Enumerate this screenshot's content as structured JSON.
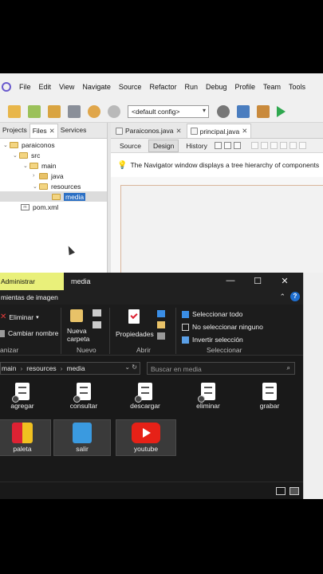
{
  "netbeans": {
    "menu": [
      "File",
      "Edit",
      "View",
      "Navigate",
      "Source",
      "Refactor",
      "Run",
      "Debug",
      "Profile",
      "Team",
      "Tools"
    ],
    "config_select": "<default config>",
    "left_tabs": [
      "Projects",
      "Files",
      "Services"
    ],
    "tree": {
      "root": "paraiconos",
      "src": "src",
      "main": "main",
      "java": "java",
      "resources": "resources",
      "media": "media",
      "pom": "pom.xml"
    },
    "editor_tabs": [
      "Paraiconos.java",
      "principal.java"
    ],
    "design_buttons": [
      "Source",
      "Design",
      "History"
    ],
    "navigator_hint": "The Navigator window displays a tree hierarchy of components"
  },
  "explorer": {
    "ribbon_context_tab": "Administrar",
    "window_title": "media",
    "ribbon_tab": "mientas de imagen",
    "window_buttons": [
      "—",
      "☐",
      "✕"
    ],
    "ribbon": {
      "delete": "Eliminar",
      "rename": "Cambiar nombre",
      "new_folder": "Nueva\ncarpeta",
      "properties": "Propiedades",
      "select_all": "Seleccionar todo",
      "select_none": "No seleccionar ninguno",
      "invert": "Invertir selección",
      "groups": [
        "anizar",
        "Nuevo",
        "Abrir",
        "Seleccionar"
      ]
    },
    "breadcrumb": [
      "main",
      "resources",
      "media"
    ],
    "search_placeholder": "Buscar en media",
    "files_row1": [
      "agregar",
      "consultar",
      "descargar",
      "eliminar",
      "grabar"
    ],
    "files_row2": [
      "paleta",
      "salir",
      "youtube"
    ]
  },
  "colors": {
    "context_tab": "#e9f07a",
    "explorer_bg": "#191919",
    "selection": "#2b6fc4",
    "youtube_red": "#e62117"
  }
}
